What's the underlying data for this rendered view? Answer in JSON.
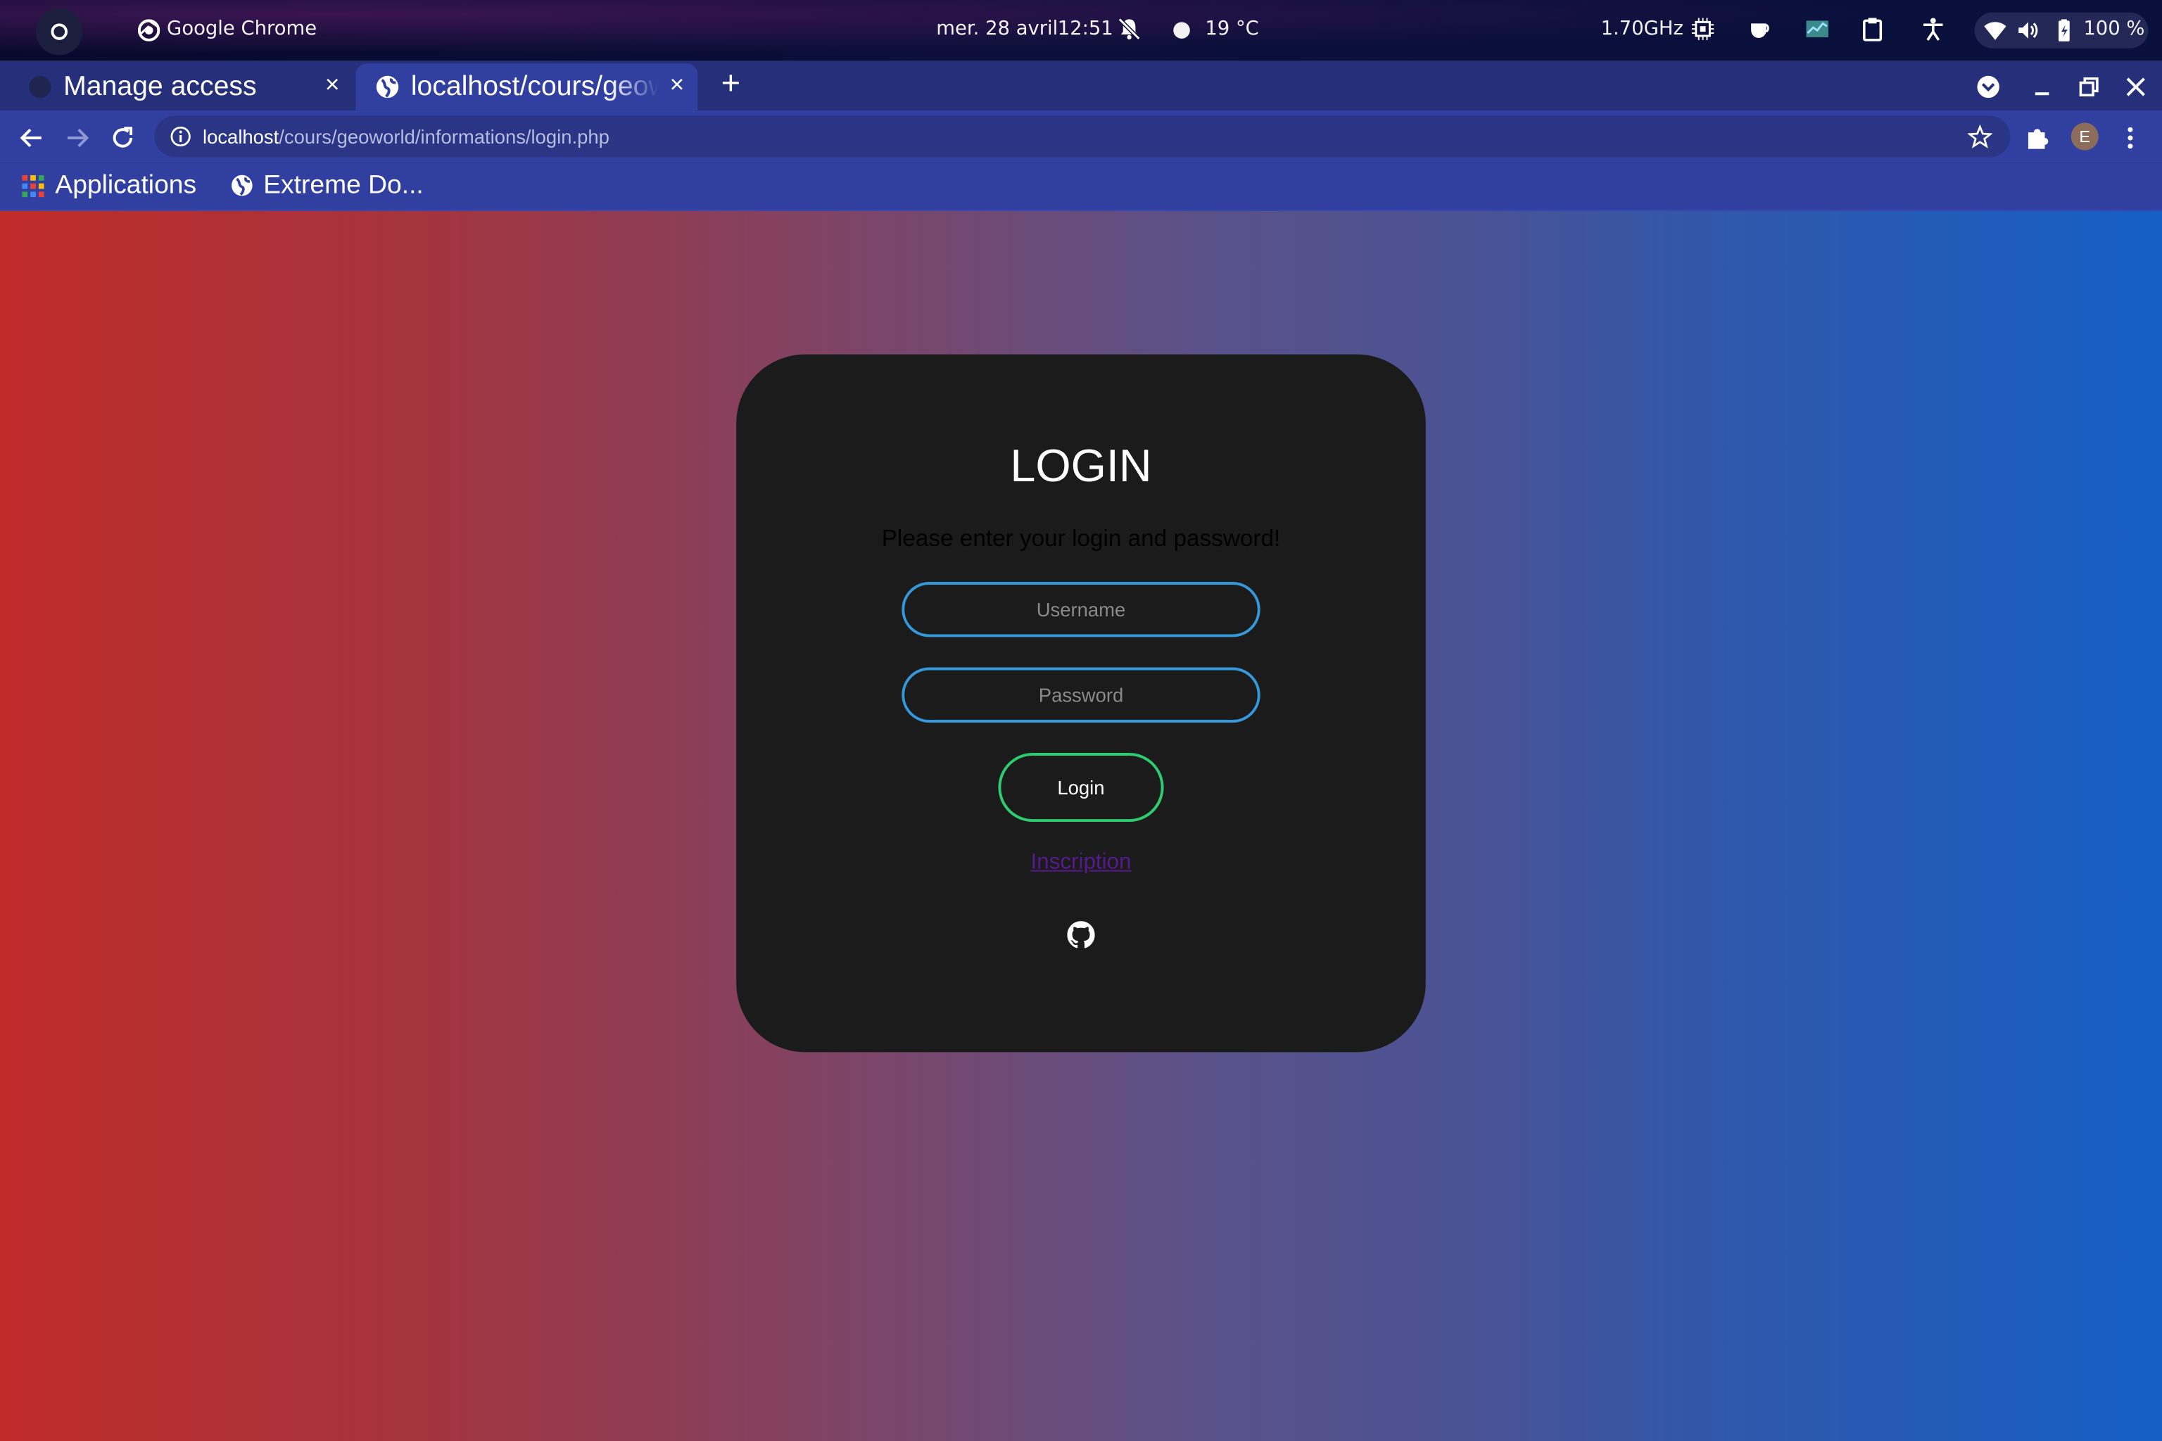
{
  "system_bar": {
    "app_name": "Google Chrome",
    "date": "mer. 28 avril",
    "time": "12:51",
    "weather": "19 °C",
    "cpu_freq": "1.70GHz",
    "battery": "100 %"
  },
  "tabs": [
    {
      "title": "Manage access",
      "close": "×"
    },
    {
      "title": "localhost/cours/geoworld/informations/login.php",
      "close": "×"
    }
  ],
  "new_tab": "+",
  "toolbar": {
    "url_host": "localhost",
    "url_path": "/cours/geoworld/informations/login.php",
    "avatar_letter": "E"
  },
  "bookmarks": [
    {
      "label": "Applications"
    },
    {
      "label": "Extreme Do..."
    }
  ],
  "login": {
    "title": "LOGIN",
    "subtitle": "Please enter your login and password!",
    "username_placeholder": "Username",
    "password_placeholder": "Password",
    "button": "Login",
    "register_link": "Inscription"
  },
  "colors": {
    "input_border": "#3498db",
    "button_border": "#2ecc71",
    "card_bg": "#1b1b1b",
    "chrome_frame": "#303fa0"
  }
}
